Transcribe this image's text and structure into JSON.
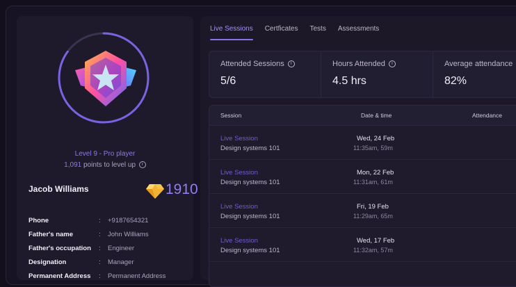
{
  "profile": {
    "level_text": "Level 9 - Pro player",
    "points_number": "1,091",
    "points_suffix": " points to level up",
    "name": "Jacob Williams",
    "score": "1910",
    "details": [
      {
        "label": "Phone",
        "value": "+9187654321"
      },
      {
        "label": "Father's name",
        "value": "John Williams"
      },
      {
        "label": "Father's occupation",
        "value": "Engineer"
      },
      {
        "label": "Designation",
        "value": "Manager"
      },
      {
        "label": "Permanent Address",
        "value": "Permanent Address"
      }
    ],
    "colon": ":",
    "level_progress": 0.85
  },
  "tabs": [
    "Live Sessions",
    "Certficates",
    "Tests",
    "Assessments"
  ],
  "active_tab": "Live Sessions",
  "stats": [
    {
      "label": "Attended Sessions",
      "value": "5/6"
    },
    {
      "label": "Hours Attended",
      "value": "4.5 hrs"
    },
    {
      "label": "Average attendance",
      "value": "82%"
    }
  ],
  "table": {
    "headers": {
      "session": "Session",
      "date": "Date & time",
      "attendance": "Attendance"
    },
    "rows": [
      {
        "type": "Live Session",
        "name": "Design systems 101",
        "date": "Wed, 24 Feb",
        "time": "11:35am, 59m"
      },
      {
        "type": "Live Session",
        "name": "Design systems 101",
        "date": "Mon, 22 Feb",
        "time": "11:31am, 61m"
      },
      {
        "type": "Live Session",
        "name": "Design systems 101",
        "date": "Fri, 19 Feb",
        "time": "11:29am, 65m"
      },
      {
        "type": "Live Session",
        "name": "Design systems 101",
        "date": "Wed, 17 Feb",
        "time": "11:32am, 57m"
      }
    ]
  },
  "colors": {
    "accent": "#8572ea",
    "background": "#130f1c",
    "card": "#1e1a2b"
  }
}
